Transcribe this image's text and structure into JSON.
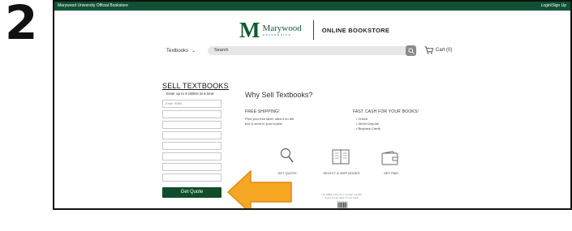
{
  "step_number": "2",
  "topbar": {
    "left_text": "Marywood University Official Bookstore",
    "right_text": "Login/Sign Up"
  },
  "brand": {
    "letter": "M",
    "name": "Marywood",
    "sub": "UNIVERSITY",
    "store": "ONLINE BOOKSTORE"
  },
  "nav": {
    "textbooks_label": "Textbooks",
    "search_placeholder": "Search",
    "cart_label": "Cart (0)"
  },
  "sell": {
    "title": "SELL TEXTBOOKS",
    "hint": "Enter up to 8 ISBNs at a time:",
    "isbn_placeholder": "Enter ISBN",
    "button_label": "Get Quote"
  },
  "why": {
    "title": "Why Sell Textbooks?",
    "free_shipping": {
      "heading": "FREE SHIPPING!",
      "line1": "Print your free label, stick it on the",
      "line2": "box & send in your books!"
    },
    "fast_cash": {
      "heading": "FAST CASH FOR YOUR BOOKS!",
      "items": [
        "• Check",
        "• Direct Deposit",
        "• Buyback Credit"
      ]
    }
  },
  "steps": [
    {
      "label": "GET QUOTE",
      "icon": "magnifier-icon"
    },
    {
      "label": "SELECT & SHIP BOOKS",
      "icon": "book-icon"
    },
    {
      "label": "GET PAID",
      "icon": "wallet-icon"
    }
  ],
  "isbn_note": {
    "line1": "The ISBN is the 10 or 13 digit number",
    "line2": "found on the back of your book"
  },
  "colors": {
    "brand_green": "#0f5132",
    "button_green": "#0f4d2b",
    "arrow_orange": "#f5a623"
  }
}
